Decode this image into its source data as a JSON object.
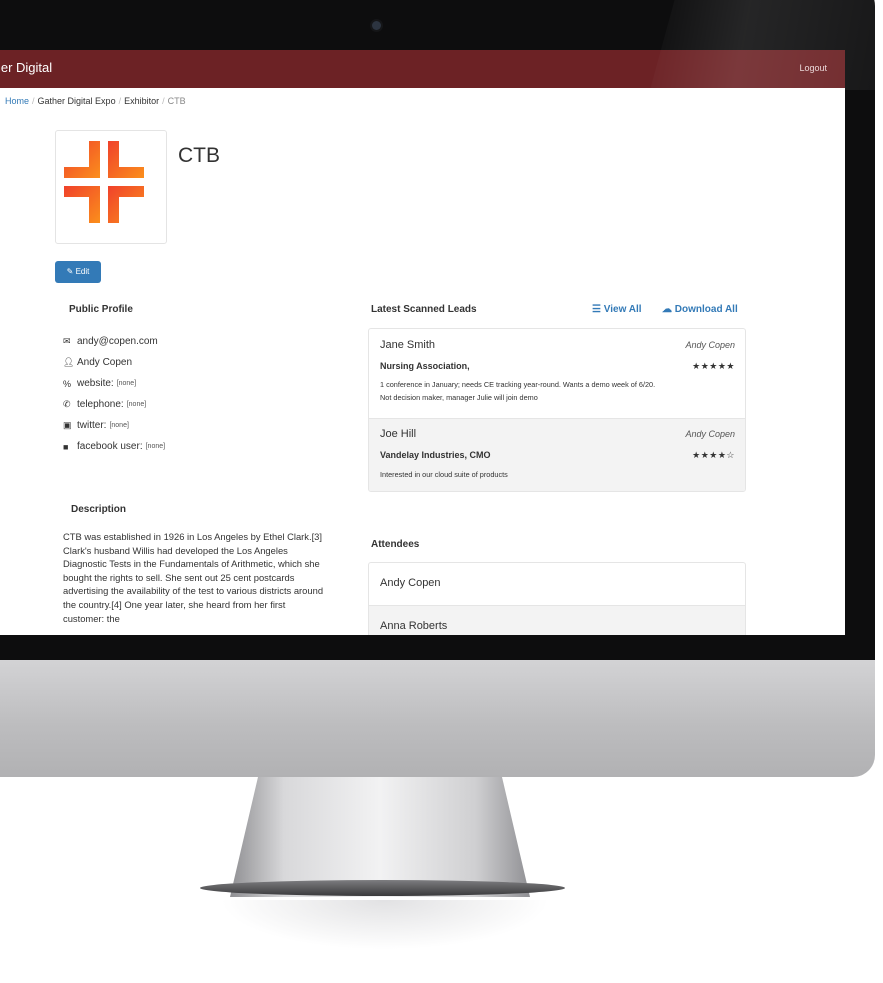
{
  "nav": {
    "brand": "ther Digital",
    "logout": "Logout"
  },
  "breadcrumb": {
    "home": "Home",
    "expo": "Gather Digital Expo",
    "section": "Exhibitor",
    "current": "CTB",
    "separator": "/"
  },
  "company": {
    "name": "CTB",
    "logo_colors": [
      "#f0412b",
      "#fb8f1c"
    ]
  },
  "edit_button": {
    "label": "Edit"
  },
  "public_profile": {
    "title": "Public Profile",
    "email": "andy@copen.com",
    "contact_name": "Andy Copen",
    "website_label": "website:",
    "website_value": "[none]",
    "telephone_label": "telephone:",
    "telephone_value": "[none]",
    "twitter_label": "twitter:",
    "twitter_value": "[none]",
    "facebook_label": "facebook user:",
    "facebook_value": "[none]"
  },
  "description": {
    "title": "Description",
    "text": "CTB was established in 1926 in Los Angeles by Ethel Clark.[3] Clark's husband Willis had developed the Los Angeles Diagnostic Tests in the Fundamentals of Arithmetic, which she bought the rights to sell. She sent out 25 cent postcards advertising the availability of the test to various districts around the country.[4] One year later, she heard from her first customer: the"
  },
  "leads": {
    "title": "Latest Scanned Leads",
    "view_all": "View All",
    "download_all": "Download All",
    "items": [
      {
        "name": "Jane Smith",
        "owner": "Andy Copen",
        "org": "Nursing Association,",
        "stars": "★★★★★",
        "note_line1": "1 conference in January; needs CE tracking year-round. Wants a demo week of 6/20.",
        "note_line2": "Not decision maker, manager Julie will join demo"
      },
      {
        "name": "Joe Hill",
        "owner": "Andy Copen",
        "org": "Vandelay Industries, CMO",
        "stars": "★★★★☆",
        "note_line1": "Interested in our cloud suite of products"
      }
    ]
  },
  "attendees": {
    "title": "Attendees",
    "items": [
      {
        "name": "Andy Copen"
      },
      {
        "name": "Anna Roberts"
      }
    ]
  },
  "colors": {
    "nav_bg": "#6c2225",
    "link": "#337ab7",
    "button": "#337ab7"
  }
}
